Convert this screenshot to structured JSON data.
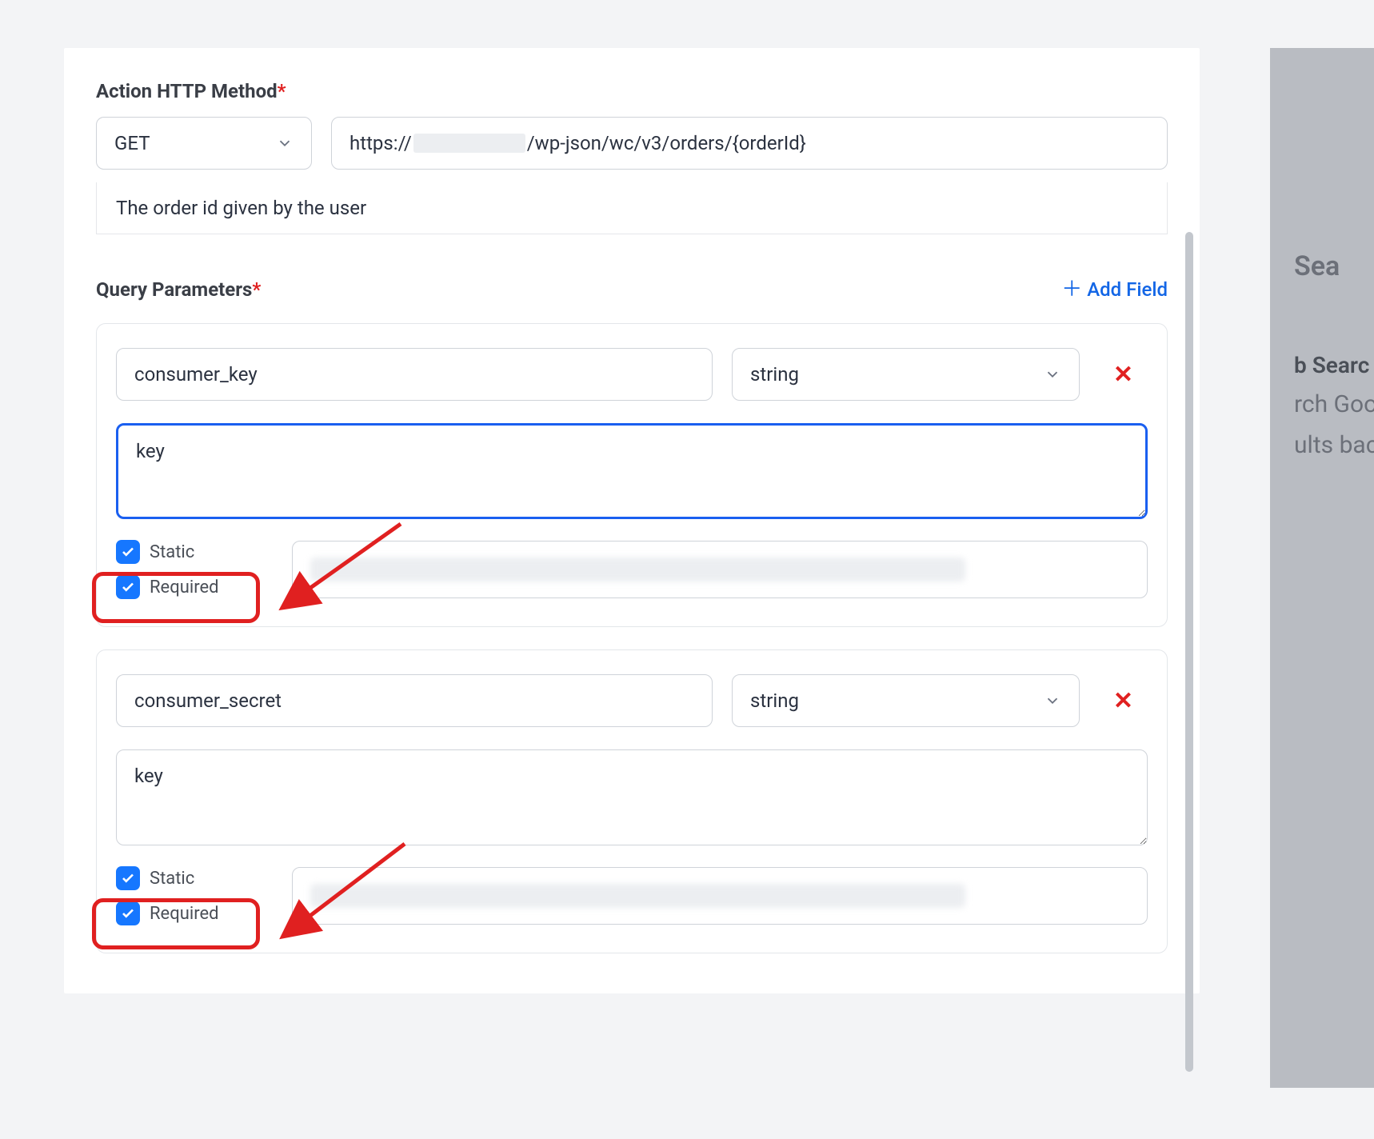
{
  "section": {
    "http_method_label": "Action HTTP Method",
    "method": "GET",
    "url_prefix": "https://",
    "url_suffix": "/wp-json/wc/v3/orders/{orderId}",
    "description": "The order id given by the user",
    "query_params_label": "Query Parameters",
    "add_field_label": "Add Field"
  },
  "params": [
    {
      "name": "consumer_key",
      "type": "string",
      "desc": "key",
      "static_label": "Static",
      "required_label": "Required",
      "static_checked": true,
      "required_checked": true,
      "desc_focused": true
    },
    {
      "name": "consumer_secret",
      "type": "string",
      "desc": "key",
      "static_label": "Static",
      "required_label": "Required",
      "static_checked": true,
      "required_checked": true,
      "desc_focused": false
    }
  ],
  "bg": {
    "sea": "Sea",
    "bsearch": "b Searc",
    "rchgoo": "rch Goo",
    "ultsback": "ults back"
  }
}
